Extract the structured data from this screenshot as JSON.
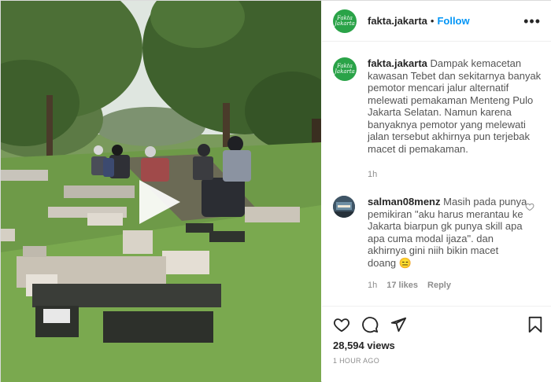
{
  "post": {
    "account": "fakta.jakarta",
    "avatar_text": [
      "Fakta",
      "Jakarta"
    ],
    "separator": "•",
    "follow_label": "Follow",
    "more_icon": "more-horizontal-icon",
    "caption": {
      "username": "fakta.jakarta",
      "text": "Dampak kemacetan kawasan Tebet dan sekitarnya banyak pemotor mencari jalur alternatif melewati pemakaman Menteng Pulo Jakarta Selatan. Namun karena banyaknya pemotor yang melewati jalan tersebut akhirnya pun terjebak macet di pemakaman.",
      "time": "1h"
    },
    "comment": {
      "username": "salman08menz",
      "text": "Masih pada punya pemikiran \"aku harus merantau ke Jakarta biarpun gk punya skill apa apa cuma modal ijaza\". dan akhirnya gini niih bikin macet doang",
      "emoji": "😑",
      "time": "1h",
      "likes": "17 likes",
      "reply_label": "Reply"
    },
    "views": "28,594 views",
    "posted_ago": "1 HOUR AGO"
  },
  "colors": {
    "brand_green": "#2aa348",
    "follow_blue": "#0095f6",
    "text_primary": "#262626",
    "text_secondary": "#8e8e8e"
  },
  "icons": [
    "play-icon",
    "heart-icon",
    "comment-icon",
    "share-icon",
    "bookmark-icon",
    "heart-small-icon"
  ]
}
